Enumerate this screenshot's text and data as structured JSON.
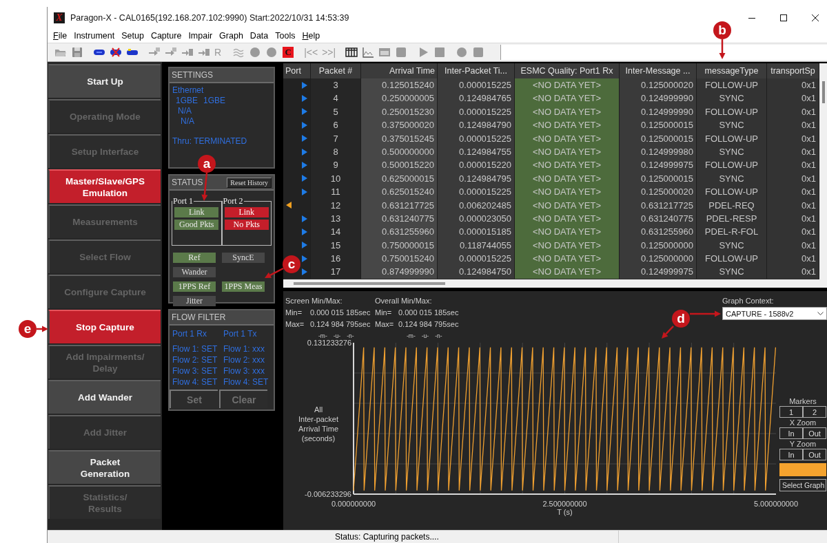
{
  "window": {
    "logo_letter": "X",
    "title": "Paragon-X - CAL0165(192.168.207.102:9990) Start:2022/10/31 14:53:39"
  },
  "menu": [
    {
      "label": "File",
      "underline_first": true
    },
    {
      "label": "Instrument",
      "underline_first": false
    },
    {
      "label": "Setup",
      "underline_first": false
    },
    {
      "label": "Capture",
      "underline_first": false
    },
    {
      "label": "Impair",
      "underline_first": false
    },
    {
      "label": "Graph",
      "underline_first": false
    },
    {
      "label": "Data",
      "underline_first": false
    },
    {
      "label": "Tools",
      "underline_first": false
    },
    {
      "label": "Help",
      "underline_first": true
    }
  ],
  "toolbar": {
    "r_label": "R",
    "c_label": "C",
    "first_label": "|<<",
    "last_label": ">>|"
  },
  "nav": [
    {
      "label": "Start Up",
      "kind": "enabled"
    },
    {
      "label": "Operating Mode",
      "kind": "disabled"
    },
    {
      "label": "Setup Interface",
      "kind": "disabled"
    },
    {
      "label": "Master/Slave/GPS\nEmulation",
      "kind": "highlighted"
    },
    {
      "label": "Measurements",
      "kind": "disabled"
    },
    {
      "label": "Select Flow",
      "kind": "disabled"
    },
    {
      "label": "Configure Capture",
      "kind": "disabled"
    },
    {
      "label": "Stop Capture",
      "kind": "highlighted"
    },
    {
      "label": "Add Impairments/\nDelay",
      "kind": "disabled"
    },
    {
      "label": "Add Wander",
      "kind": "enabled"
    },
    {
      "label": "Add Jitter",
      "kind": "disabled"
    },
    {
      "label": "Packet\nGeneration",
      "kind": "enabled"
    },
    {
      "label": "Statistics/\nResults",
      "kind": "disabled"
    }
  ],
  "settings": {
    "title": "SETTINGS",
    "lines": [
      [
        "Ethernet"
      ],
      [
        "1GBE",
        "1GBE"
      ],
      [
        "N/A"
      ],
      [
        "N/A"
      ],
      [
        "Thru: TERMINATED"
      ]
    ]
  },
  "status": {
    "title": "STATUS",
    "reset_button": "Reset History",
    "ports": [
      {
        "label": "Port 1",
        "badges": [
          {
            "label": "Link",
            "kind": "good"
          },
          {
            "label": "Good Pkts",
            "kind": "good"
          }
        ]
      },
      {
        "label": "Port 2",
        "badges": [
          {
            "label": "Link",
            "kind": "bad"
          },
          {
            "label": "No Pkts",
            "kind": "bad"
          }
        ]
      }
    ],
    "indicator_rows": [
      [
        {
          "label": "Ref",
          "kind": "good"
        },
        {
          "label": "SyncE",
          "kind": "idle"
        }
      ],
      [
        {
          "label": "Wander",
          "kind": "idle"
        }
      ],
      [
        {
          "label": "1PPS Ref",
          "kind": "good"
        },
        {
          "label": "1PPS Meas",
          "kind": "good"
        }
      ],
      [
        {
          "label": "Jitter",
          "kind": "idle"
        }
      ]
    ]
  },
  "flow_filter": {
    "title": "FLOW FILTER",
    "columns": [
      {
        "heading": "Port 1 Rx",
        "flows": [
          "Flow 1: SET",
          "Flow 2: SET",
          "Flow 3: SET",
          "Flow 4: SET"
        ]
      },
      {
        "heading": "Port 1 Tx",
        "flows": [
          "Flow 1: xxx",
          "Flow 2: xxx",
          "Flow 3: xxx",
          "Flow 4: SET"
        ]
      }
    ],
    "buttons": [
      "Set",
      "Clear"
    ]
  },
  "table": {
    "columns": [
      "Port",
      "Packet #",
      "Arrival Time",
      "Inter-Packet Ti...",
      "ESMC Quality: Port1 Rx",
      "Inter-Message ...",
      "messageType",
      "transportSp"
    ],
    "rows": [
      {
        "kind": "right",
        "cells": [
          "",
          "3",
          "0.125015240",
          "0.000015225",
          "<NO DATA YET>",
          "0.125000020",
          "FOLLOW-UP",
          "0x1"
        ]
      },
      {
        "kind": "right",
        "cells": [
          "",
          "4",
          "0.250000005",
          "0.124984765",
          "<NO DATA YET>",
          "0.124999990",
          "SYNC",
          "0x1"
        ]
      },
      {
        "kind": "right",
        "cells": [
          "",
          "5",
          "0.250015230",
          "0.000015225",
          "<NO DATA YET>",
          "0.124999990",
          "FOLLOW-UP",
          "0x1"
        ]
      },
      {
        "kind": "right",
        "cells": [
          "",
          "6",
          "0.375000020",
          "0.124984790",
          "<NO DATA YET>",
          "0.125000015",
          "SYNC",
          "0x1"
        ]
      },
      {
        "kind": "right",
        "cells": [
          "",
          "7",
          "0.375015245",
          "0.000015225",
          "<NO DATA YET>",
          "0.125000015",
          "FOLLOW-UP",
          "0x1"
        ]
      },
      {
        "kind": "right",
        "cells": [
          "",
          "8",
          "0.500000000",
          "0.124984755",
          "<NO DATA YET>",
          "0.124999980",
          "SYNC",
          "0x1"
        ]
      },
      {
        "kind": "right",
        "cells": [
          "",
          "9",
          "0.500015220",
          "0.000015220",
          "<NO DATA YET>",
          "0.124999975",
          "FOLLOW-UP",
          "0x1"
        ]
      },
      {
        "kind": "right",
        "cells": [
          "",
          "10",
          "0.625000015",
          "0.124984795",
          "<NO DATA YET>",
          "0.125000015",
          "SYNC",
          "0x1"
        ]
      },
      {
        "kind": "right",
        "cells": [
          "",
          "11",
          "0.625015240",
          "0.000015225",
          "<NO DATA YET>",
          "0.125000020",
          "FOLLOW-UP",
          "0x1"
        ]
      },
      {
        "kind": "left",
        "cells": [
          "",
          "12",
          "0.631217725",
          "0.006202485",
          "<NO DATA YET>",
          "0.631217725",
          "PDEL-REQ",
          "0x1"
        ]
      },
      {
        "kind": "right",
        "cells": [
          "",
          "13",
          "0.631240775",
          "0.000023050",
          "<NO DATA YET>",
          "0.631240775",
          "PDEL-RESP",
          "0x1"
        ]
      },
      {
        "kind": "right",
        "cells": [
          "",
          "14",
          "0.631255960",
          "0.000015185",
          "<NO DATA YET>",
          "0.631255960",
          "PDEL-R-FOL",
          "0x1"
        ]
      },
      {
        "kind": "right",
        "cells": [
          "",
          "15",
          "0.750000015",
          "0.118744055",
          "<NO DATA YET>",
          "0.125000000",
          "SYNC",
          "0x1"
        ]
      },
      {
        "kind": "right",
        "cells": [
          "",
          "16",
          "0.750015240",
          "0.000015225",
          "<NO DATA YET>",
          "0.125000000",
          "FOLLOW-UP",
          "0x1"
        ]
      },
      {
        "kind": "right",
        "cells": [
          "",
          "17",
          "0.874999990",
          "0.124984750",
          "<NO DATA YET>",
          "0.124999975",
          "SYNC",
          "0x1"
        ]
      }
    ]
  },
  "graph": {
    "screen_title": "Screen Min/Max:",
    "overall_title": "Overall Min/Max:",
    "stats": [
      {
        "screen_label": "Min=",
        "screen_value": "0.000 015 185sec",
        "overall_label": "Min=",
        "overall_value": "0.000 015 185sec"
      },
      {
        "screen_label": "Max=",
        "screen_value": "0.124 984 795sec",
        "overall_label": "Max=",
        "overall_value": "0.124 984 795sec"
      }
    ],
    "unit_marks": [
      [
        "-m-",
        "-u-",
        "-n-"
      ],
      [
        "-m-",
        "-u-",
        "-n-"
      ]
    ],
    "context_label": "Graph Context:",
    "context_value": "CAPTURE - 1588v2",
    "chart_data": {
      "type": "line",
      "xlabel": "T (s)",
      "ylabel": "All\nInter-packet\nArrival Time\n(seconds)",
      "x": [
        0,
        0.12,
        0.125,
        0.245,
        0.25,
        0.37,
        0.375,
        0.495,
        0.5,
        0.62,
        0.625,
        0.745,
        0.75,
        0.87,
        0.875,
        0.995,
        1,
        1.12,
        1.125,
        1.245,
        1.25,
        1.37,
        1.375,
        1.495,
        1.5,
        1.62,
        1.625,
        1.745,
        1.75,
        1.87,
        1.875,
        1.995,
        2,
        2.12,
        2.125,
        2.245,
        2.25,
        2.37,
        2.375,
        2.495,
        2.5,
        2.62,
        2.625,
        2.745,
        2.75,
        2.87,
        2.875,
        2.995,
        3,
        3.12,
        3.125,
        3.245,
        3.25,
        3.37,
        3.375,
        3.495,
        3.5,
        3.62,
        3.625,
        3.745,
        3.75,
        3.87,
        3.875,
        3.995,
        4,
        4.12,
        4.125,
        4.245,
        4.25,
        4.37,
        4.375,
        4.495,
        4.5,
        4.62,
        4.625,
        4.745,
        4.75,
        4.87,
        4.875,
        4.995
      ],
      "series": [
        {
          "color": "#f0a030",
          "values": [
            -0.003,
            0.127,
            -0.003,
            0.127,
            -0.003,
            0.127,
            -0.003,
            0.127,
            -0.003,
            0.127,
            -0.003,
            0.127,
            -0.003,
            0.127,
            -0.003,
            0.127,
            -0.003,
            0.127,
            -0.003,
            0.127,
            -0.003,
            0.127,
            -0.003,
            0.127,
            -0.003,
            0.127,
            -0.003,
            0.127,
            -0.003,
            0.127,
            -0.003,
            0.127,
            -0.003,
            0.127,
            -0.003,
            0.127,
            -0.003,
            0.127,
            -0.003,
            0.127,
            -0.003,
            0.127,
            -0.003,
            0.127,
            -0.003,
            0.127,
            -0.003,
            0.127,
            -0.003,
            0.127,
            -0.003,
            0.127,
            -0.003,
            0.127,
            -0.003,
            0.127,
            -0.003,
            0.127,
            -0.003,
            0.127,
            -0.003,
            0.127,
            -0.003,
            0.127,
            -0.003,
            0.127,
            -0.003,
            0.127,
            -0.003,
            0.127,
            -0.003,
            0.127,
            -0.003,
            0.127,
            -0.003,
            0.127,
            -0.003,
            0.127,
            -0.003,
            0.127
          ]
        }
      ],
      "xlim": [
        0,
        5
      ],
      "ylim": [
        -0.006233296,
        0.131233276
      ],
      "xticks": [
        {
          "value": 0,
          "label": "0.000000000"
        },
        {
          "value": 2.5,
          "label": "2.500000000"
        },
        {
          "value": 5,
          "label": "5.000000000"
        }
      ],
      "yticks": [
        {
          "value": -0.006233296,
          "label": "-0.006233296"
        },
        {
          "value": 0.131233276,
          "label": "0.131233276"
        }
      ]
    },
    "controls": {
      "markers_label": "Markers",
      "marker_buttons": [
        "1",
        "2"
      ],
      "xzoom_label": "X Zoom",
      "xzoom_buttons": [
        "In",
        "Out"
      ],
      "yzoom_label": "Y Zoom",
      "yzoom_buttons": [
        "In",
        "Out"
      ],
      "select_label": "Select Graph"
    }
  },
  "status_bar": "Status: Capturing packets....",
  "callouts": [
    {
      "letter": "a"
    },
    {
      "letter": "b"
    },
    {
      "letter": "c"
    },
    {
      "letter": "d"
    },
    {
      "letter": "e"
    }
  ]
}
